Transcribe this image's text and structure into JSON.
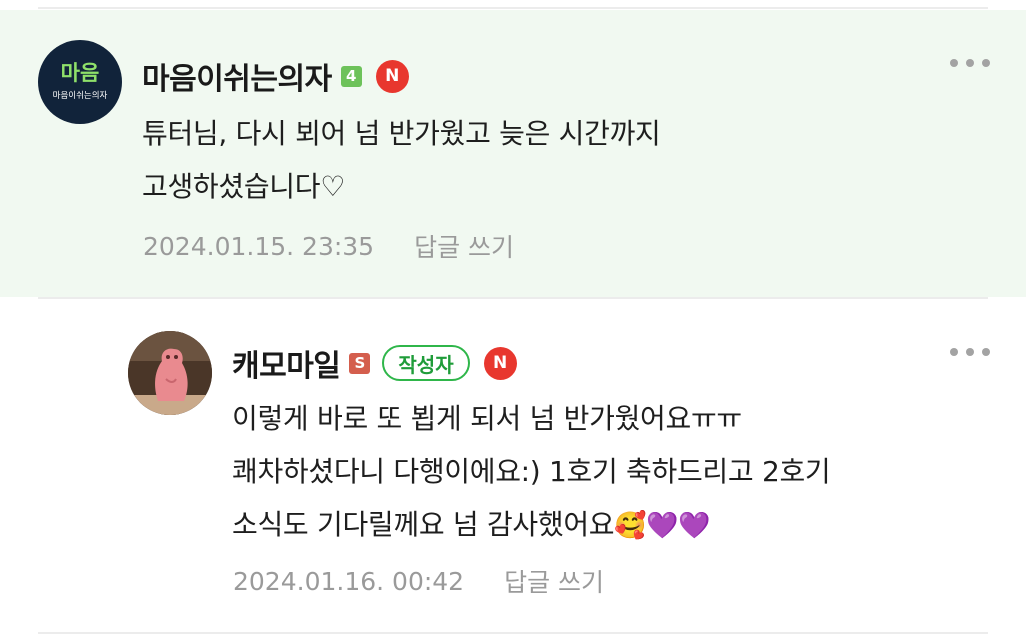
{
  "comments": [
    {
      "nickname": "마음이쉬는의자",
      "avatar_text_large": "마음",
      "avatar_text_small": "마음이쉬는의자",
      "level": "4",
      "naver_badge": "N",
      "body": "튜터님, 다시 뵈어 넘 반가웠고 늦은 시간까지\n고생하셨습니다♡",
      "timestamp": "2024.01.15. 23:35",
      "reply_label": "답글 쓰기",
      "more_icon": "more-dots-icon"
    },
    {
      "nickname": "캐모마일",
      "level": "S",
      "author_badge": "작성자",
      "naver_badge": "N",
      "body": "이렇게 바로 또 뵙게 되서 넘 반가웠어요ㅠㅠ\n쾌차하셨다니 다행이에요:) 1호기 축하드리고 2호기\n소식도 기다릴께요 넘 감사했어요",
      "emojis": "🥰💜💜",
      "timestamp": "2024.01.16. 00:42",
      "reply_label": "답글 쓰기",
      "more_icon": "more-dots-icon"
    }
  ],
  "colors": {
    "highlight_bg": "#f1f9f1",
    "author_badge": "#2fb64a",
    "naver_badge": "#e8372e",
    "meta_text": "#9a9a9a"
  }
}
